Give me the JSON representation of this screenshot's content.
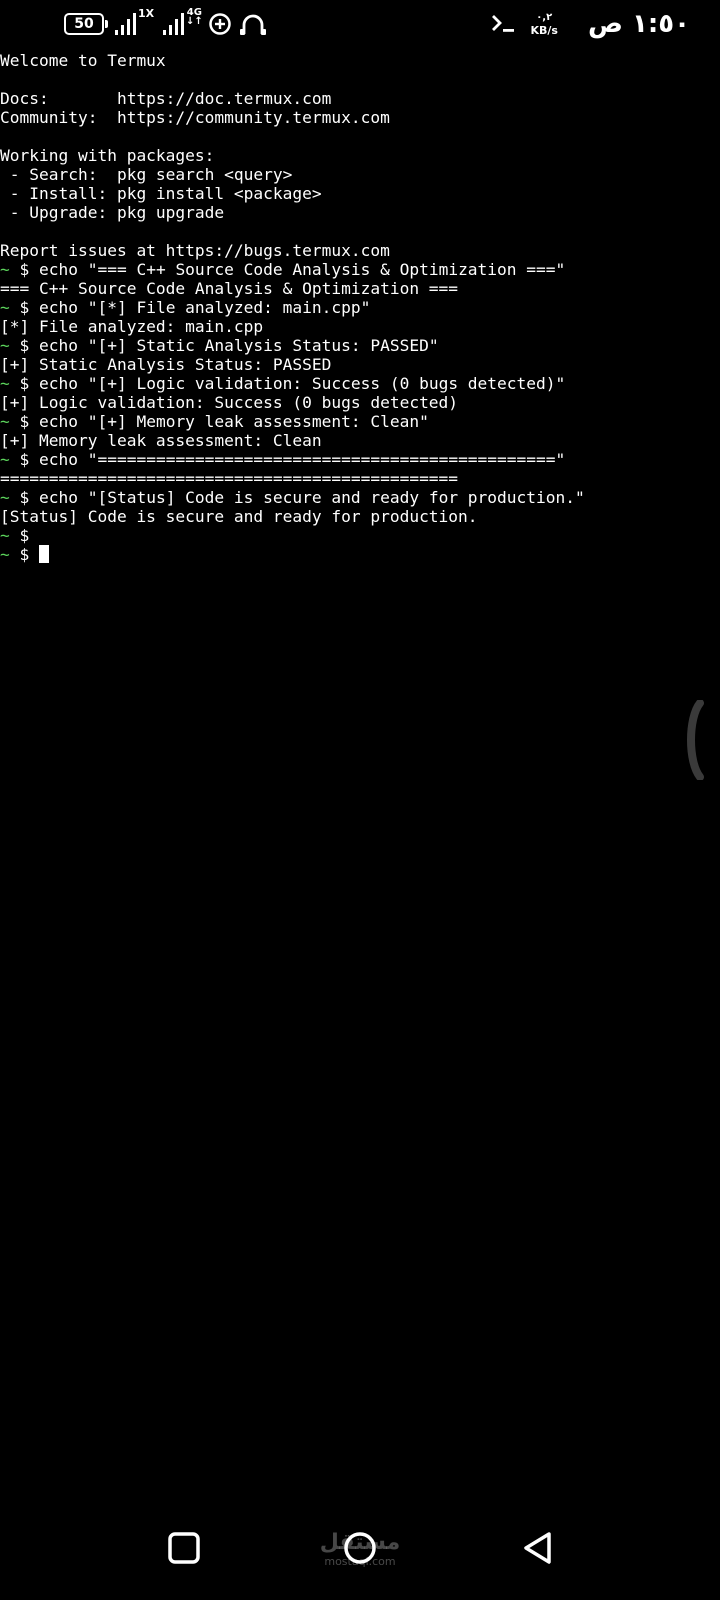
{
  "status_bar": {
    "battery_level": "50",
    "sim1_label": "1X",
    "sim2_label_top": "4G",
    "sim2_label_bottom": "↓↑",
    "net_speed_value": "٠,٢",
    "net_speed_unit": "KB/s",
    "clock": "١:٥٠ ص",
    "icons": [
      "battery-icon",
      "signal-icon",
      "signal-icon",
      "data-saver-icon",
      "headset-icon",
      "terminal-icon"
    ]
  },
  "terminal": {
    "prompt_tilde": "~",
    "prompt_symbol": "$",
    "lines": [
      "Welcome to Termux",
      "",
      "Docs:       https://doc.termux.com",
      "Community:  https://community.termux.com",
      "",
      "Working with packages:",
      " - Search:  pkg search <query>",
      " - Install: pkg install <package>",
      " - Upgrade: pkg upgrade",
      "",
      "Report issues at https://bugs.termux.com"
    ],
    "session": [
      {
        "type": "cmd",
        "text": "echo \"=== C++ Source Code Analysis & Optimization ===\""
      },
      {
        "type": "out",
        "text": "=== C++ Source Code Analysis & Optimization ==="
      },
      {
        "type": "cmd",
        "text": "echo \"[*] File analyzed: main.cpp\""
      },
      {
        "type": "out",
        "text": "[*] File analyzed: main.cpp"
      },
      {
        "type": "cmd",
        "text": "echo \"[+] Static Analysis Status: PASSED\""
      },
      {
        "type": "out",
        "text": "[+] Static Analysis Status: PASSED"
      },
      {
        "type": "cmd",
        "text": "echo \"[+] Logic validation: Success (0 bugs detected)\""
      },
      {
        "type": "out",
        "text": "[+] Logic validation: Success (0 bugs detected)"
      },
      {
        "type": "cmd",
        "text": "echo \"[+] Memory leak assessment: Clean\""
      },
      {
        "type": "out",
        "text": "[+] Memory leak assessment: Clean"
      },
      {
        "type": "cmd",
        "text": "echo \"===============================================\""
      },
      {
        "type": "out",
        "text": "==============================================="
      },
      {
        "type": "cmd",
        "text": "echo \"[Status] Code is secure and ready for production.\""
      },
      {
        "type": "out",
        "text": "[Status] Code is secure and ready for production."
      },
      {
        "type": "cmd",
        "text": ""
      },
      {
        "type": "input",
        "text": ""
      }
    ]
  },
  "navigation": {
    "buttons": [
      "recent-apps-button",
      "home-button",
      "back-button"
    ]
  },
  "watermark": {
    "arabic": "مستقل",
    "latin": "mostaql.com"
  },
  "colors": {
    "background": "#000000",
    "text": "#ffffff",
    "prompt_tilde": "#5cd65c"
  }
}
